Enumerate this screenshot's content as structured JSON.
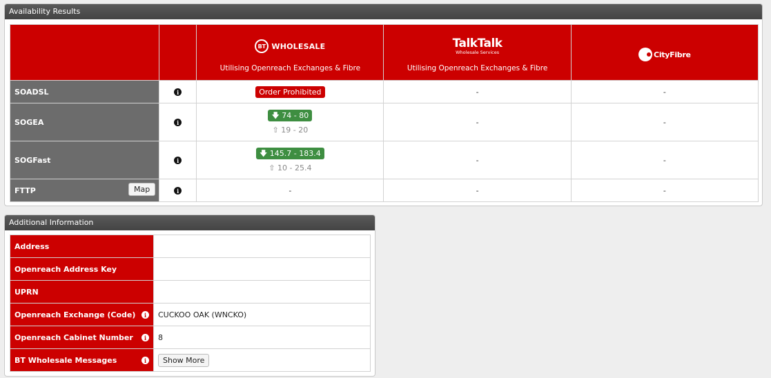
{
  "availability": {
    "title": "Availability Results",
    "providers": [
      {
        "logo_main": "WHOLESALE",
        "logo_badge": "BT",
        "subtitle": "Utilising Openreach Exchanges & Fibre"
      },
      {
        "logo_main": "TalkTalk",
        "logo_sub": "Wholesale Services",
        "subtitle": "Utilising Openreach Exchanges & Fibre"
      },
      {
        "logo_main": "CityFibre",
        "subtitle": ""
      }
    ],
    "rows": [
      {
        "label": "SOADSL",
        "bt_badge": "Order Prohibited",
        "talktalk": "-",
        "cityfibre": "-"
      },
      {
        "label": "SOGEA",
        "bt_down": "74 - 80",
        "bt_up": "19 - 20",
        "talktalk": "-",
        "cityfibre": "-"
      },
      {
        "label": "SOGFast",
        "bt_down": "145.7 - 183.4",
        "bt_up": "10 - 25.4",
        "talktalk": "-",
        "cityfibre": "-"
      },
      {
        "label": "FTTP",
        "map_label": "Map",
        "bt": "-",
        "talktalk": "-",
        "cityfibre": "-"
      }
    ],
    "info_glyph": "i",
    "down_arrow": "🡇",
    "up_arrow": "⇧"
  },
  "additional": {
    "title": "Additional Information",
    "rows": [
      {
        "label": "Address",
        "value": ""
      },
      {
        "label": "Openreach Address Key",
        "value": ""
      },
      {
        "label": "UPRN",
        "value": ""
      },
      {
        "label": "Openreach Exchange (Code)",
        "value": "CUCKOO OAK (WNCKO)"
      },
      {
        "label": "Openreach Cabinet Number",
        "value": "8"
      },
      {
        "label": "BT Wholesale Messages",
        "button": "Show More"
      }
    ]
  },
  "colors": {
    "brand_red": "#cc0000",
    "header_grey": "#4a4a4a",
    "row_grey": "#6c6c6c",
    "speed_green": "#3e8e41"
  }
}
